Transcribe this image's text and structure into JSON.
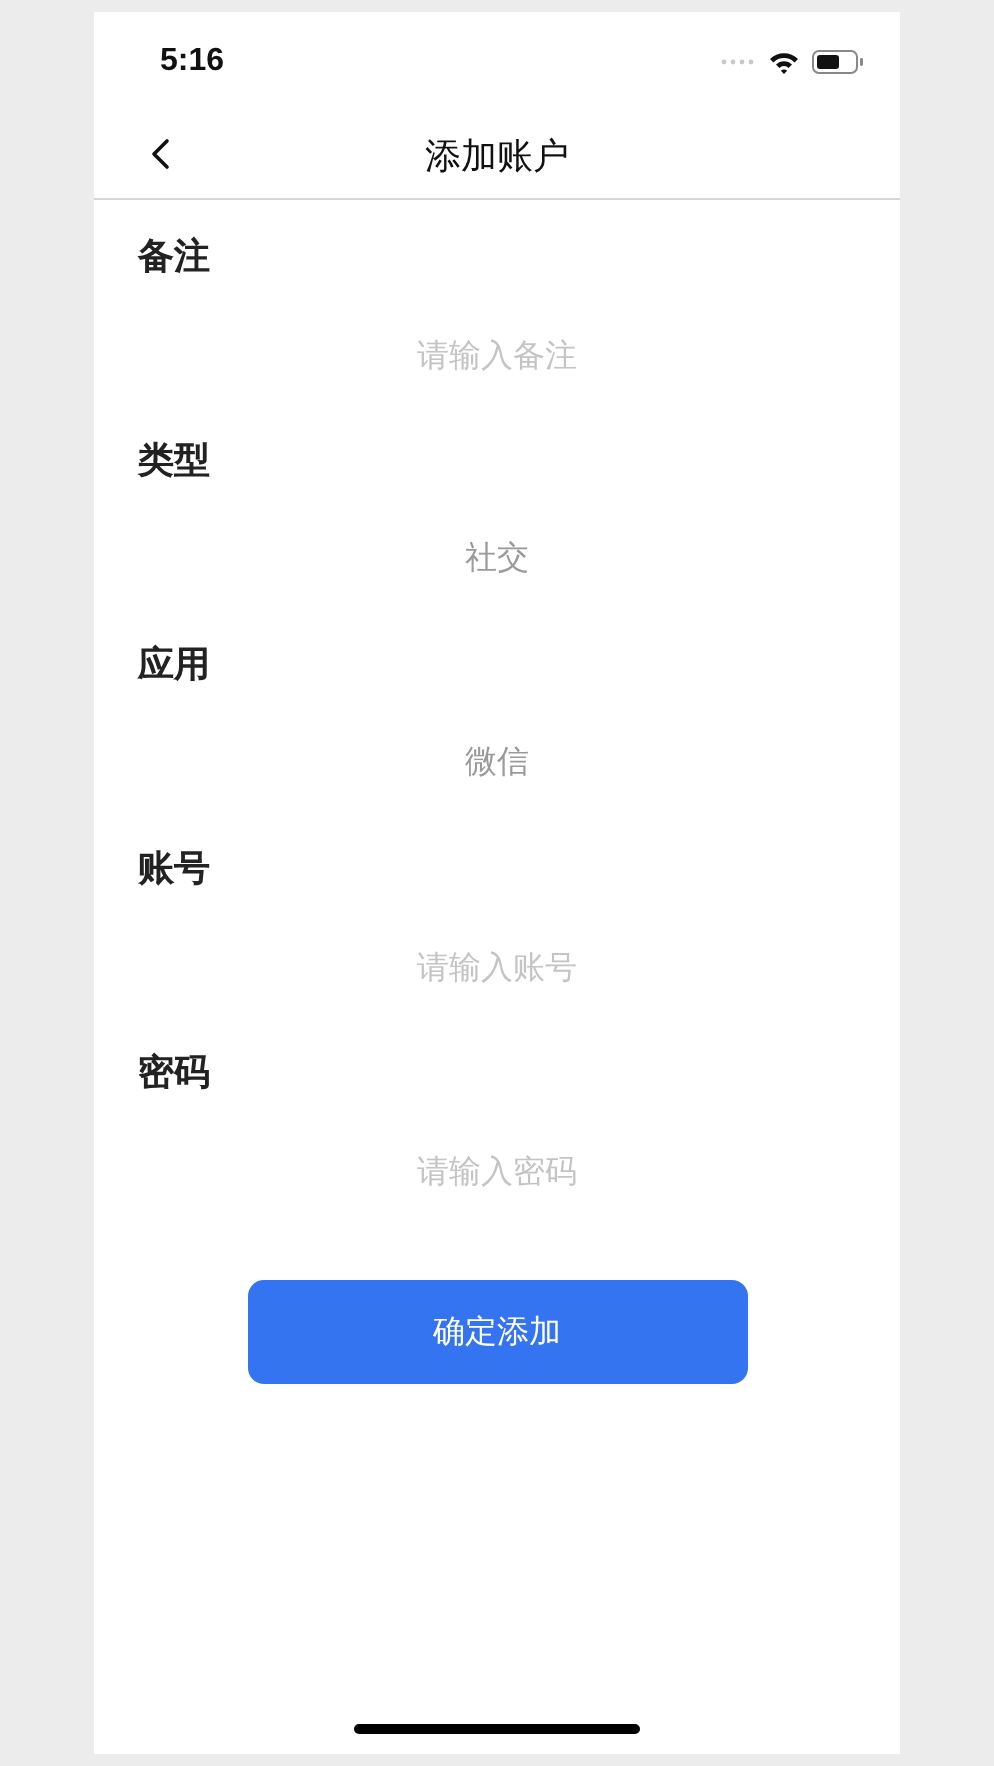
{
  "status_bar": {
    "time": "5:16"
  },
  "header": {
    "title": "添加账户"
  },
  "fields": [
    {
      "label": "备注",
      "kind": "input",
      "placeholder": "请输入备注"
    },
    {
      "label": "类型",
      "kind": "picker",
      "value": "社交"
    },
    {
      "label": "应用",
      "kind": "picker",
      "value": "微信"
    },
    {
      "label": "账号",
      "kind": "input",
      "placeholder": "请输入账号"
    },
    {
      "label": "密码",
      "kind": "input",
      "placeholder": "请输入密码"
    }
  ],
  "submit_button": "确定添加"
}
